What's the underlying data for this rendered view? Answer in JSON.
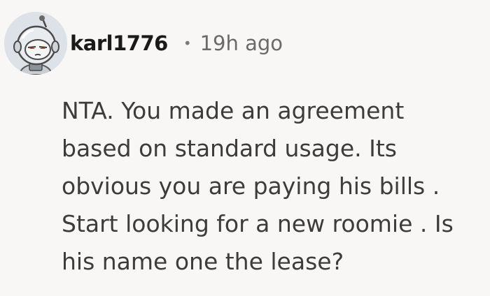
{
  "comment": {
    "author": "karl1776",
    "separator": "•",
    "timestamp": "19h ago",
    "avatar_icon": "astronaut-snoo-avatar-icon",
    "body": "NTA. You made an agreement\nbased on standard usage. Its\nobvious you are paying his bills .\nStart looking for a new roomie . Is\nhis name one the lease?"
  },
  "colors": {
    "background": "#f8f7f5",
    "username": "#1a1a1a",
    "meta": "#6a6a6a",
    "body": "#3c3c3c"
  }
}
